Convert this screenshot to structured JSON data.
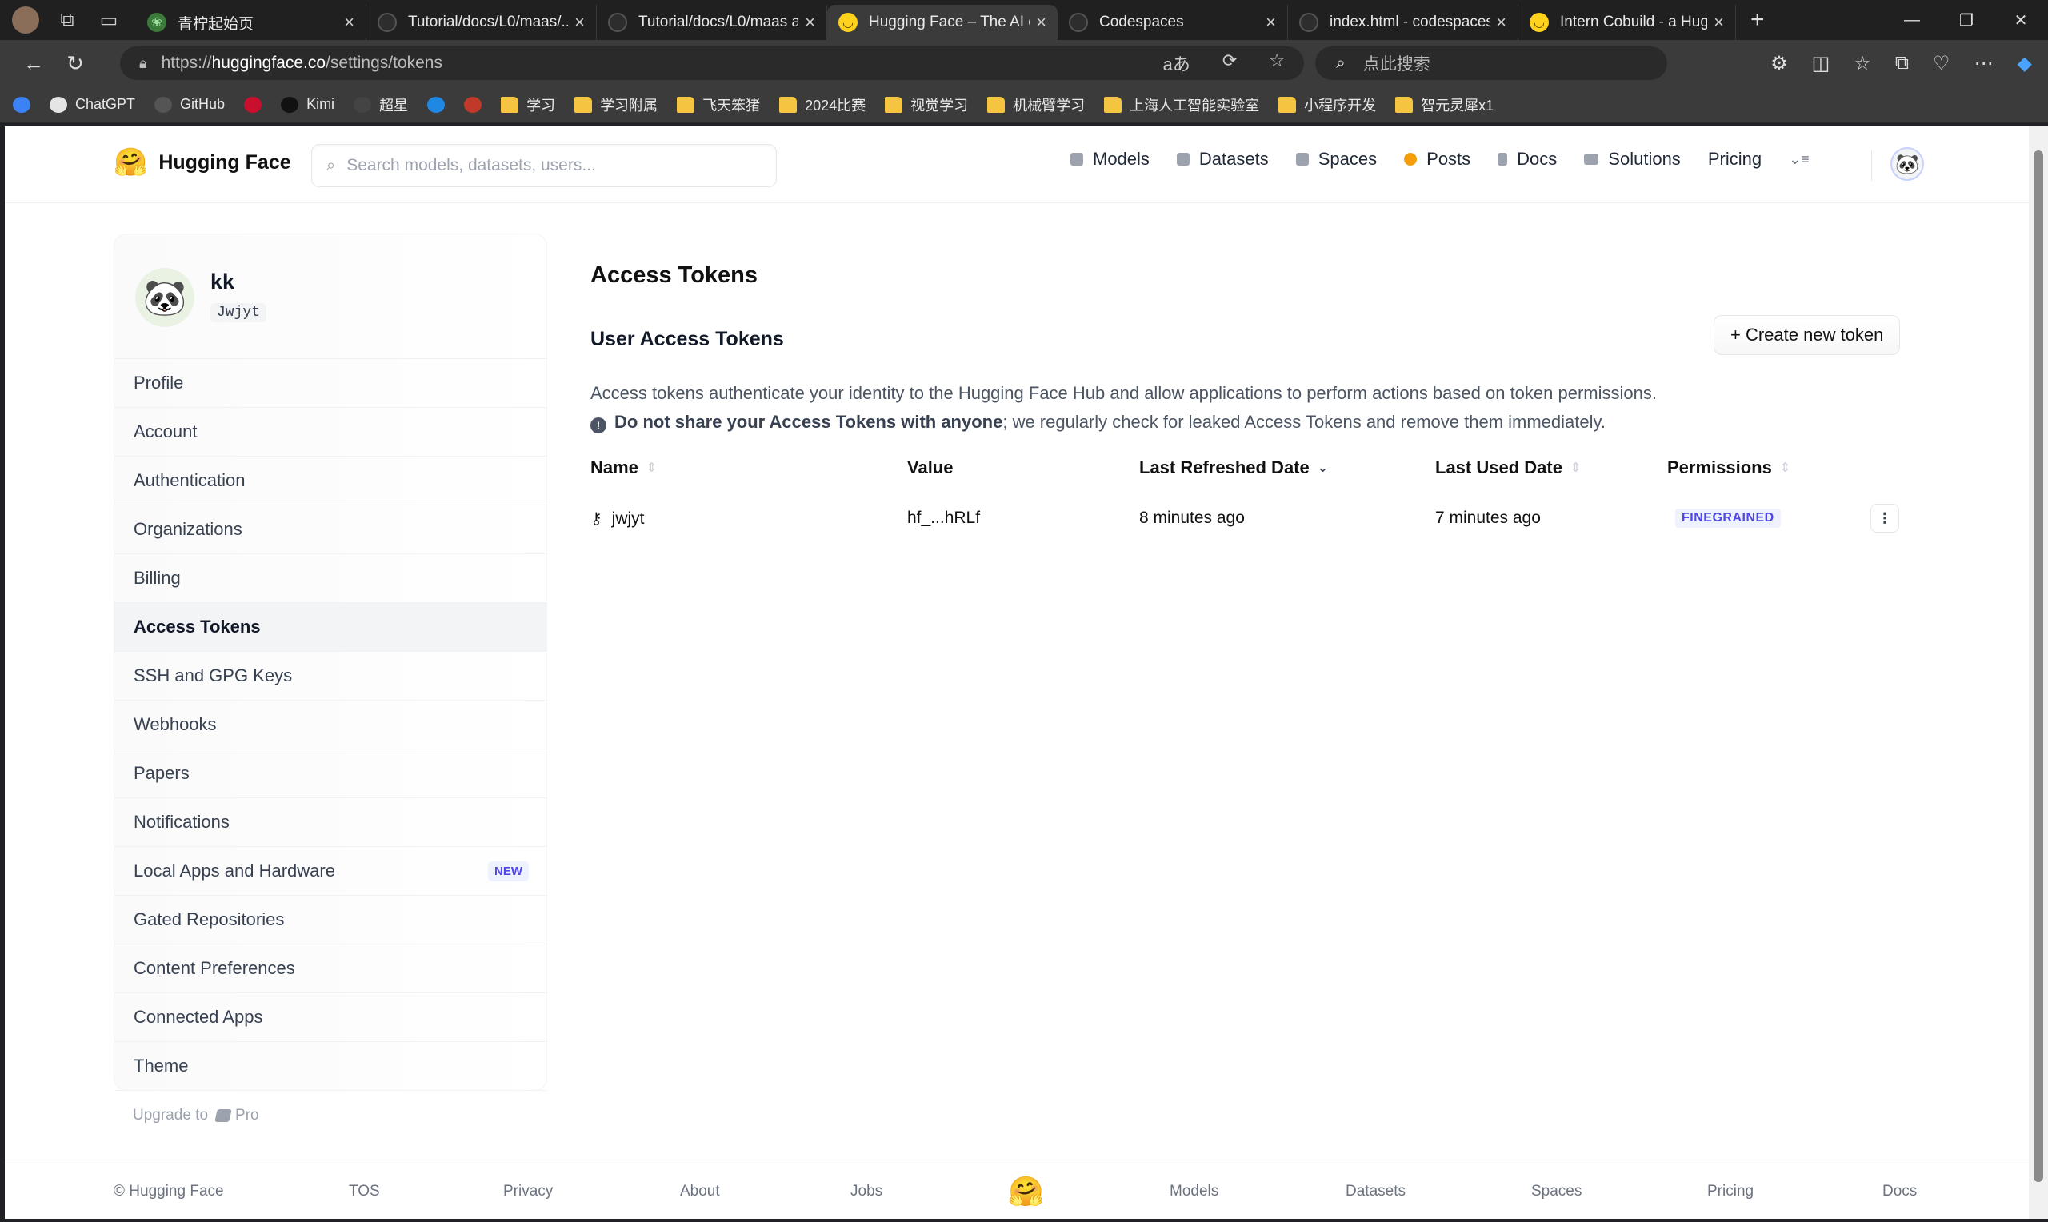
{
  "browser": {
    "tabs": [
      {
        "title": "青柠起始页",
        "icon": "leaf-icon",
        "active": false
      },
      {
        "title": "Tutorial/docs/L0/maas/...",
        "icon": "github-icon",
        "active": false
      },
      {
        "title": "Tutorial/docs/L0/maas a...",
        "icon": "github-icon",
        "active": false
      },
      {
        "title": "Hugging Face – The AI c...",
        "icon": "hugging-face-icon",
        "active": true
      },
      {
        "title": "Codespaces",
        "icon": "github-icon",
        "active": false
      },
      {
        "title": "index.html - codespaces-...",
        "icon": "github-icon",
        "active": false
      },
      {
        "title": "Intern Cobuild - a Huggi...",
        "icon": "hugging-face-icon",
        "active": false
      }
    ],
    "url_prefix": "https://",
    "url_host": "huggingface.co",
    "url_path": "/settings/tokens",
    "search_placeholder": "点此搜索",
    "bookmarks": [
      {
        "label": "",
        "icon": "app-icon"
      },
      {
        "label": "ChatGPT",
        "icon": "openai-icon"
      },
      {
        "label": "GitHub",
        "icon": "github-icon"
      },
      {
        "label": "",
        "icon": "huawei-icon"
      },
      {
        "label": "Kimi",
        "icon": "kimi-icon"
      },
      {
        "label": "超星",
        "icon": "chaoxing-icon"
      },
      {
        "label": "",
        "icon": "bilibili-icon"
      },
      {
        "label": "",
        "icon": "globe-icon"
      },
      {
        "label": "学习",
        "icon": "folder-icon"
      },
      {
        "label": "学习附属",
        "icon": "folder-icon"
      },
      {
        "label": "飞天笨猪",
        "icon": "folder-icon"
      },
      {
        "label": "2024比赛",
        "icon": "folder-icon"
      },
      {
        "label": "视觉学习",
        "icon": "folder-icon"
      },
      {
        "label": "机械臂学习",
        "icon": "folder-icon"
      },
      {
        "label": "上海人工智能实验室",
        "icon": "folder-icon"
      },
      {
        "label": "小程序开发",
        "icon": "folder-icon"
      },
      {
        "label": "智元灵犀x1",
        "icon": "folder-icon"
      }
    ]
  },
  "header": {
    "brand": "Hugging Face",
    "search_placeholder": "Search models, datasets, users...",
    "nav": [
      {
        "label": "Models",
        "icon": "models-icon",
        "color": "#9ca3af"
      },
      {
        "label": "Datasets",
        "icon": "datasets-icon",
        "color": "#9ca3af"
      },
      {
        "label": "Spaces",
        "icon": "spaces-icon",
        "color": "#9ca3af"
      },
      {
        "label": "Posts",
        "icon": "posts-icon",
        "color": "#f59e0b"
      },
      {
        "label": "Docs",
        "icon": "docs-icon",
        "color": "#9ca3af"
      },
      {
        "label": "Solutions",
        "icon": "solutions-icon",
        "color": "#9ca3af"
      },
      {
        "label": "Pricing",
        "icon": "",
        "color": ""
      }
    ]
  },
  "sidebar": {
    "user_name": "kk",
    "user_handle": "Jwjyt",
    "items": [
      {
        "label": "Profile",
        "selected": false
      },
      {
        "label": "Account",
        "selected": false
      },
      {
        "label": "Authentication",
        "selected": false
      },
      {
        "label": "Organizations",
        "selected": false
      },
      {
        "label": "Billing",
        "selected": false
      },
      {
        "label": "Access Tokens",
        "selected": true
      },
      {
        "label": "SSH and GPG Keys",
        "selected": false
      },
      {
        "label": "Webhooks",
        "selected": false
      },
      {
        "label": "Papers",
        "selected": false
      },
      {
        "label": "Notifications",
        "selected": false
      },
      {
        "label": "Local Apps and Hardware",
        "selected": false,
        "badge": "NEW"
      },
      {
        "label": "Gated Repositories",
        "selected": false
      },
      {
        "label": "Content Preferences",
        "selected": false
      },
      {
        "label": "Connected Apps",
        "selected": false
      },
      {
        "label": "Theme",
        "selected": false
      }
    ],
    "upgrade_label": "Upgrade to",
    "pro_label": "Pro"
  },
  "main": {
    "title": "Access Tokens",
    "section_title": "User Access Tokens",
    "create_button": "+ Create new token",
    "description_line1": "Access tokens authenticate your identity to the Hugging Face Hub and allow applications to perform actions based on token permissions.",
    "warning_bold": "Do not share your Access Tokens with anyone",
    "warning_rest": "; we regularly check for leaked Access Tokens and remove them immediately.",
    "columns": [
      "Name",
      "Value",
      "Last Refreshed Date",
      "Last Used Date",
      "Permissions"
    ],
    "rows": [
      {
        "name": "jwjyt",
        "value": "hf_...hRLf",
        "last_refreshed": "8 minutes ago",
        "last_used": "7 minutes ago",
        "permissions": "FINEGRAINED"
      }
    ]
  },
  "footer": {
    "copyright": "© Hugging Face",
    "links": [
      "TOS",
      "Privacy",
      "About",
      "Jobs",
      "Models",
      "Datasets",
      "Spaces",
      "Pricing",
      "Docs"
    ]
  }
}
